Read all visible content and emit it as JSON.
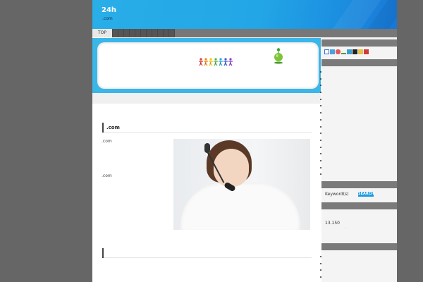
{
  "header": {
    "site_title": "24h",
    "site_subtitle": ".com",
    "colors": {
      "header_blue": "#22a6e6",
      "banner_blue": "#3ab6e8",
      "outer_gray": "#666666"
    }
  },
  "nav": {
    "top_label": "TOP"
  },
  "main": {
    "section1_title": ".com",
    "text_line1": ".com",
    "text_line2": ".com",
    "section2_title": "",
    "banner_icons": [
      "people-chain-icon",
      "globe-plant-icon"
    ]
  },
  "sidebar": {
    "icon_row": [
      "google-icon",
      "bookmark-icon",
      "link-icon",
      "pen-icon",
      "folder-icon",
      "star-icon",
      "note-icon",
      "flag-icon"
    ],
    "list1_count": 16,
    "search_label": "Keyword(s)",
    "search_button": "SEARCH",
    "counter_text": "13.150",
    "dot_text": ".",
    "list2_count": 4
  }
}
